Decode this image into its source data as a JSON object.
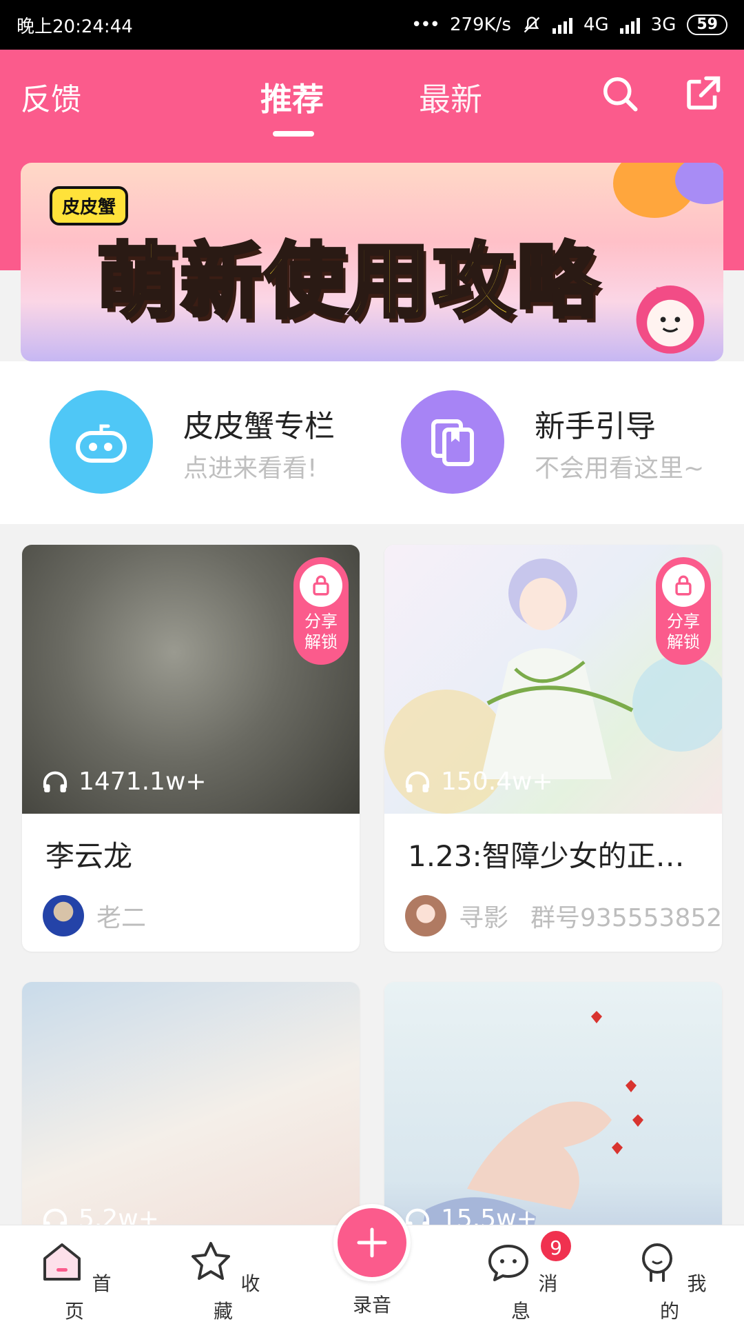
{
  "status_bar": {
    "time": "晚上20:24:44",
    "speed": "279K/s",
    "net1": "4G",
    "net2": "3G",
    "battery": "59"
  },
  "nav": {
    "feedback": "反馈",
    "tabs": [
      {
        "label": "推荐",
        "active": true
      },
      {
        "label": "最新",
        "active": false
      }
    ]
  },
  "banner": {
    "brand": "皮皮蟹",
    "title": "萌新使用攻略"
  },
  "quick": [
    {
      "title": "皮皮蟹专栏",
      "subtitle": "点进来看看!",
      "color": "#4fc7f6",
      "icon": "gamepad-icon"
    },
    {
      "title": "新手引导",
      "subtitle": "不会用看这里~",
      "color": "#a784f5",
      "icon": "book-icon"
    }
  ],
  "cards": [
    {
      "title": "李云龙",
      "plays": "1471.1w+",
      "author": "老二",
      "group": "",
      "lock_label": "分享\n解锁",
      "locked": true
    },
    {
      "title": "1.23:智障少女的正…",
      "plays": "150.4w+",
      "author": "寻影",
      "group": "群号935553852",
      "lock_label": "分享\n解锁",
      "locked": true
    },
    {
      "title": "",
      "plays": "5.2w+",
      "author": "",
      "group": "",
      "locked": false
    },
    {
      "title": "",
      "plays": "15.5w+",
      "author": "",
      "group": "",
      "locked": false
    }
  ],
  "lock_text": {
    "line1": "分享",
    "line2": "解锁"
  },
  "bottom_nav": {
    "home": "首页",
    "favorites": "收藏",
    "record": "录音",
    "messages": "消息",
    "me": "我的",
    "message_badge": "9"
  },
  "colors": {
    "accent": "#fb5b8c",
    "badge": "#f0314f"
  }
}
